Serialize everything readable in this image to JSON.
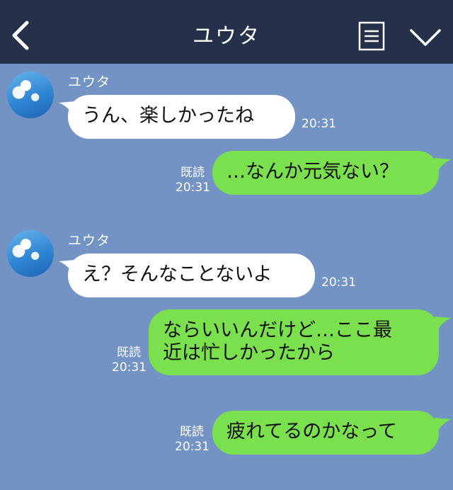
{
  "header": {
    "title": "ユウタ",
    "back_icon": "chevron-left-icon",
    "menu_icon": "notes-icon",
    "expand_icon": "chevron-down-icon",
    "background": "#25304a"
  },
  "colors": {
    "chat_background": "#7393c4",
    "incoming_bubble": "#ffffff",
    "outgoing_bubble": "#7be04e"
  },
  "messages": [
    {
      "direction": "incoming",
      "sender": "ユウタ",
      "text": "うん、楽しかったね",
      "time": "20:31"
    },
    {
      "direction": "outgoing",
      "read": "既読",
      "time": "20:31",
      "text": "…なんか元気ない？"
    },
    {
      "direction": "incoming",
      "sender": "ユウタ",
      "text": "え？そんなことないよ",
      "time": "20:31"
    },
    {
      "direction": "outgoing",
      "read": "既読",
      "time": "20:31",
      "lines": [
        "ならいいんだけど…ここ最",
        "近は忙しかったから"
      ]
    },
    {
      "direction": "outgoing",
      "read": "既読",
      "time": "20:31",
      "text": "疲れてるのかなって"
    }
  ]
}
